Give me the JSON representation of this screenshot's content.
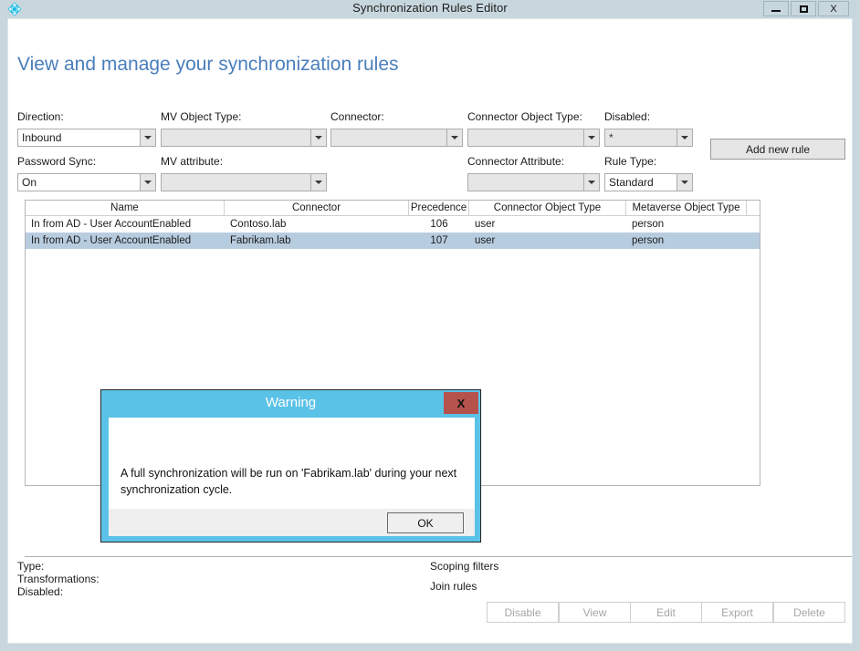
{
  "window": {
    "title": "Synchronization Rules Editor",
    "icon": "sync-diamond-icon",
    "minimize_label": "–",
    "maximize_label": "□",
    "close_label": "X"
  },
  "page": {
    "heading": "View and manage your synchronization rules"
  },
  "filters": {
    "direction": {
      "label": "Direction:",
      "value": "Inbound",
      "enabled": true
    },
    "mv_object_type": {
      "label": "MV Object Type:",
      "value": "",
      "enabled": false
    },
    "connector": {
      "label": "Connector:",
      "value": "",
      "enabled": false
    },
    "connector_object_type": {
      "label": "Connector Object Type:",
      "value": "",
      "enabled": false
    },
    "disabled": {
      "label": "Disabled:",
      "value": "*",
      "enabled": false
    },
    "password_sync": {
      "label": "Password Sync:",
      "value": "On",
      "enabled": true
    },
    "mv_attribute": {
      "label": "MV attribute:",
      "value": "",
      "enabled": false
    },
    "connector_attribute": {
      "label": "Connector Attribute:",
      "value": "",
      "enabled": false
    },
    "rule_type": {
      "label": "Rule Type:",
      "value": "Standard",
      "enabled": true
    }
  },
  "toolbar": {
    "add_new_rule_label": "Add new rule"
  },
  "grid": {
    "columns": [
      "Name",
      "Connector",
      "Precedence",
      "Connector Object Type",
      "Metaverse Object Type"
    ],
    "rows": [
      {
        "name": "In from AD - User AccountEnabled",
        "connector": "Contoso.lab",
        "precedence": "106",
        "connector_object_type": "user",
        "metaverse_object_type": "person",
        "selected": false
      },
      {
        "name": "In from AD - User AccountEnabled",
        "connector": "Fabrikam.lab",
        "precedence": "107",
        "connector_object_type": "user",
        "metaverse_object_type": "person",
        "selected": true
      }
    ]
  },
  "details": {
    "type_label": "Type:",
    "transformations_label": "Transformations:",
    "disabled_label": "Disabled:",
    "scoping_filters_label": "Scoping filters",
    "join_rules_label": "Join rules"
  },
  "actions": {
    "disable": "Disable",
    "view": "View",
    "edit": "Edit",
    "export": "Export",
    "delete": "Delete"
  },
  "dialog": {
    "title": "Warning",
    "close_label": "X",
    "message": "A full synchronization will be run on 'Fabrikam.lab' during your next synchronization cycle.",
    "ok_label": "OK"
  },
  "colors": {
    "titlebar": "#c8d7de",
    "heading": "#4a7ebb",
    "dialog_accent": "#5bc2e7",
    "dialog_close": "#b5524c",
    "row_selected": "#b8cce0",
    "icon_cyan": "#1fbbe6"
  }
}
